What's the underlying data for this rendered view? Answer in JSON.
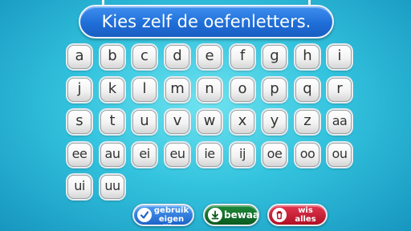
{
  "title": "Kies zelf de oefenletters.",
  "letters": [
    "a",
    "b",
    "c",
    "d",
    "e",
    "f",
    "g",
    "h",
    "i",
    "j",
    "k",
    "l",
    "m",
    "n",
    "o",
    "p",
    "q",
    "r",
    "s",
    "t",
    "u",
    "v",
    "w",
    "x",
    "y",
    "z",
    "aa",
    "ee",
    "au",
    "ei",
    "eu",
    "ie",
    "ij",
    "oe",
    "oo",
    "ou",
    "ui",
    "uu"
  ],
  "buttons": {
    "custom_list": {
      "line1": "gebruik",
      "line2": "eigen lijst",
      "icon": "checkmark-icon"
    },
    "save": {
      "label": "bewaar",
      "icon": "download-icon"
    },
    "clear": {
      "line1": "wis",
      "line2": "alles",
      "icon": "trash-icon"
    }
  },
  "colors": {
    "title_bg": "#1f6fd8",
    "custom_list": "#2d7fe0",
    "save": "#13712c",
    "clear": "#cc1f37"
  }
}
